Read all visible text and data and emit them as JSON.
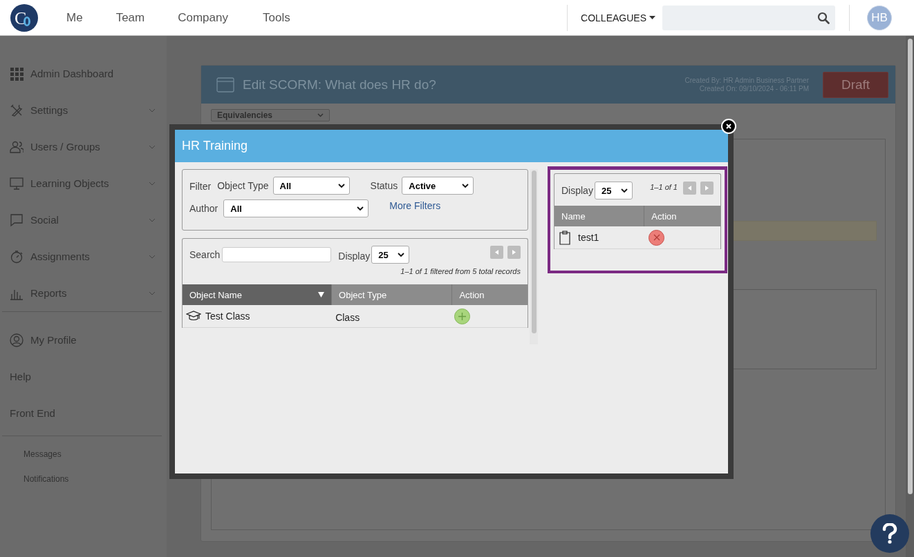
{
  "topbar": {
    "logo": "C",
    "nav": [
      {
        "label": "Me"
      },
      {
        "label": "Team"
      },
      {
        "label": "Company"
      },
      {
        "label": "Tools"
      }
    ],
    "colleagues": "COLLEAGUES",
    "avatar": "HB"
  },
  "sidebar": {
    "sections": [
      [
        {
          "label": "Admin Dashboard",
          "expandable": false
        },
        {
          "label": "Settings",
          "expandable": true
        },
        {
          "label": "Users / Groups",
          "expandable": true
        },
        {
          "label": "Learning Objects",
          "expandable": true
        },
        {
          "label": "Social",
          "expandable": true
        },
        {
          "label": "Assignments",
          "expandable": true
        },
        {
          "label": "Reports",
          "expandable": true
        }
      ],
      [
        {
          "label": "My Profile",
          "expandable": false
        },
        {
          "label": "Help",
          "expandable": false
        },
        {
          "label": "Front End",
          "expandable": false
        }
      ],
      [
        {
          "label": "Messages",
          "expandable": false
        },
        {
          "label": "Notifications",
          "expandable": false
        }
      ]
    ]
  },
  "page": {
    "title": "Edit SCORM: What does HR do?",
    "created_by": "Created By: HR Admin Business Partner",
    "created_on": "Created On: 09/10/2024 - 06:11 PM",
    "status_button": "Draft",
    "section_select": "Equivalencies"
  },
  "modal": {
    "title": "HR Training",
    "filter": {
      "label": "Filter",
      "object_type": {
        "label": "Object Type",
        "value": "All"
      },
      "status": {
        "label": "Status",
        "value": "Active"
      },
      "author": {
        "label": "Author",
        "value": "All"
      },
      "more_filters": "More Filters"
    },
    "search": {
      "label": "Search"
    },
    "display": {
      "label": "Display",
      "value": "25"
    },
    "records": "1–1 of 1 filtered from 5 total records",
    "table": {
      "columns": [
        {
          "label": "Object Name",
          "sorted": true
        },
        {
          "label": "Object Type",
          "sorted": false
        },
        {
          "label": "Action",
          "sorted": false
        }
      ],
      "rows": [
        {
          "name": "Test Class",
          "type": "Class"
        }
      ]
    },
    "selected": {
      "display": {
        "label": "Display",
        "value": "25"
      },
      "range": "1–1 of 1",
      "columns": [
        {
          "label": "Name"
        },
        {
          "label": "Action"
        }
      ],
      "rows": [
        {
          "name": "test1"
        }
      ]
    }
  }
}
